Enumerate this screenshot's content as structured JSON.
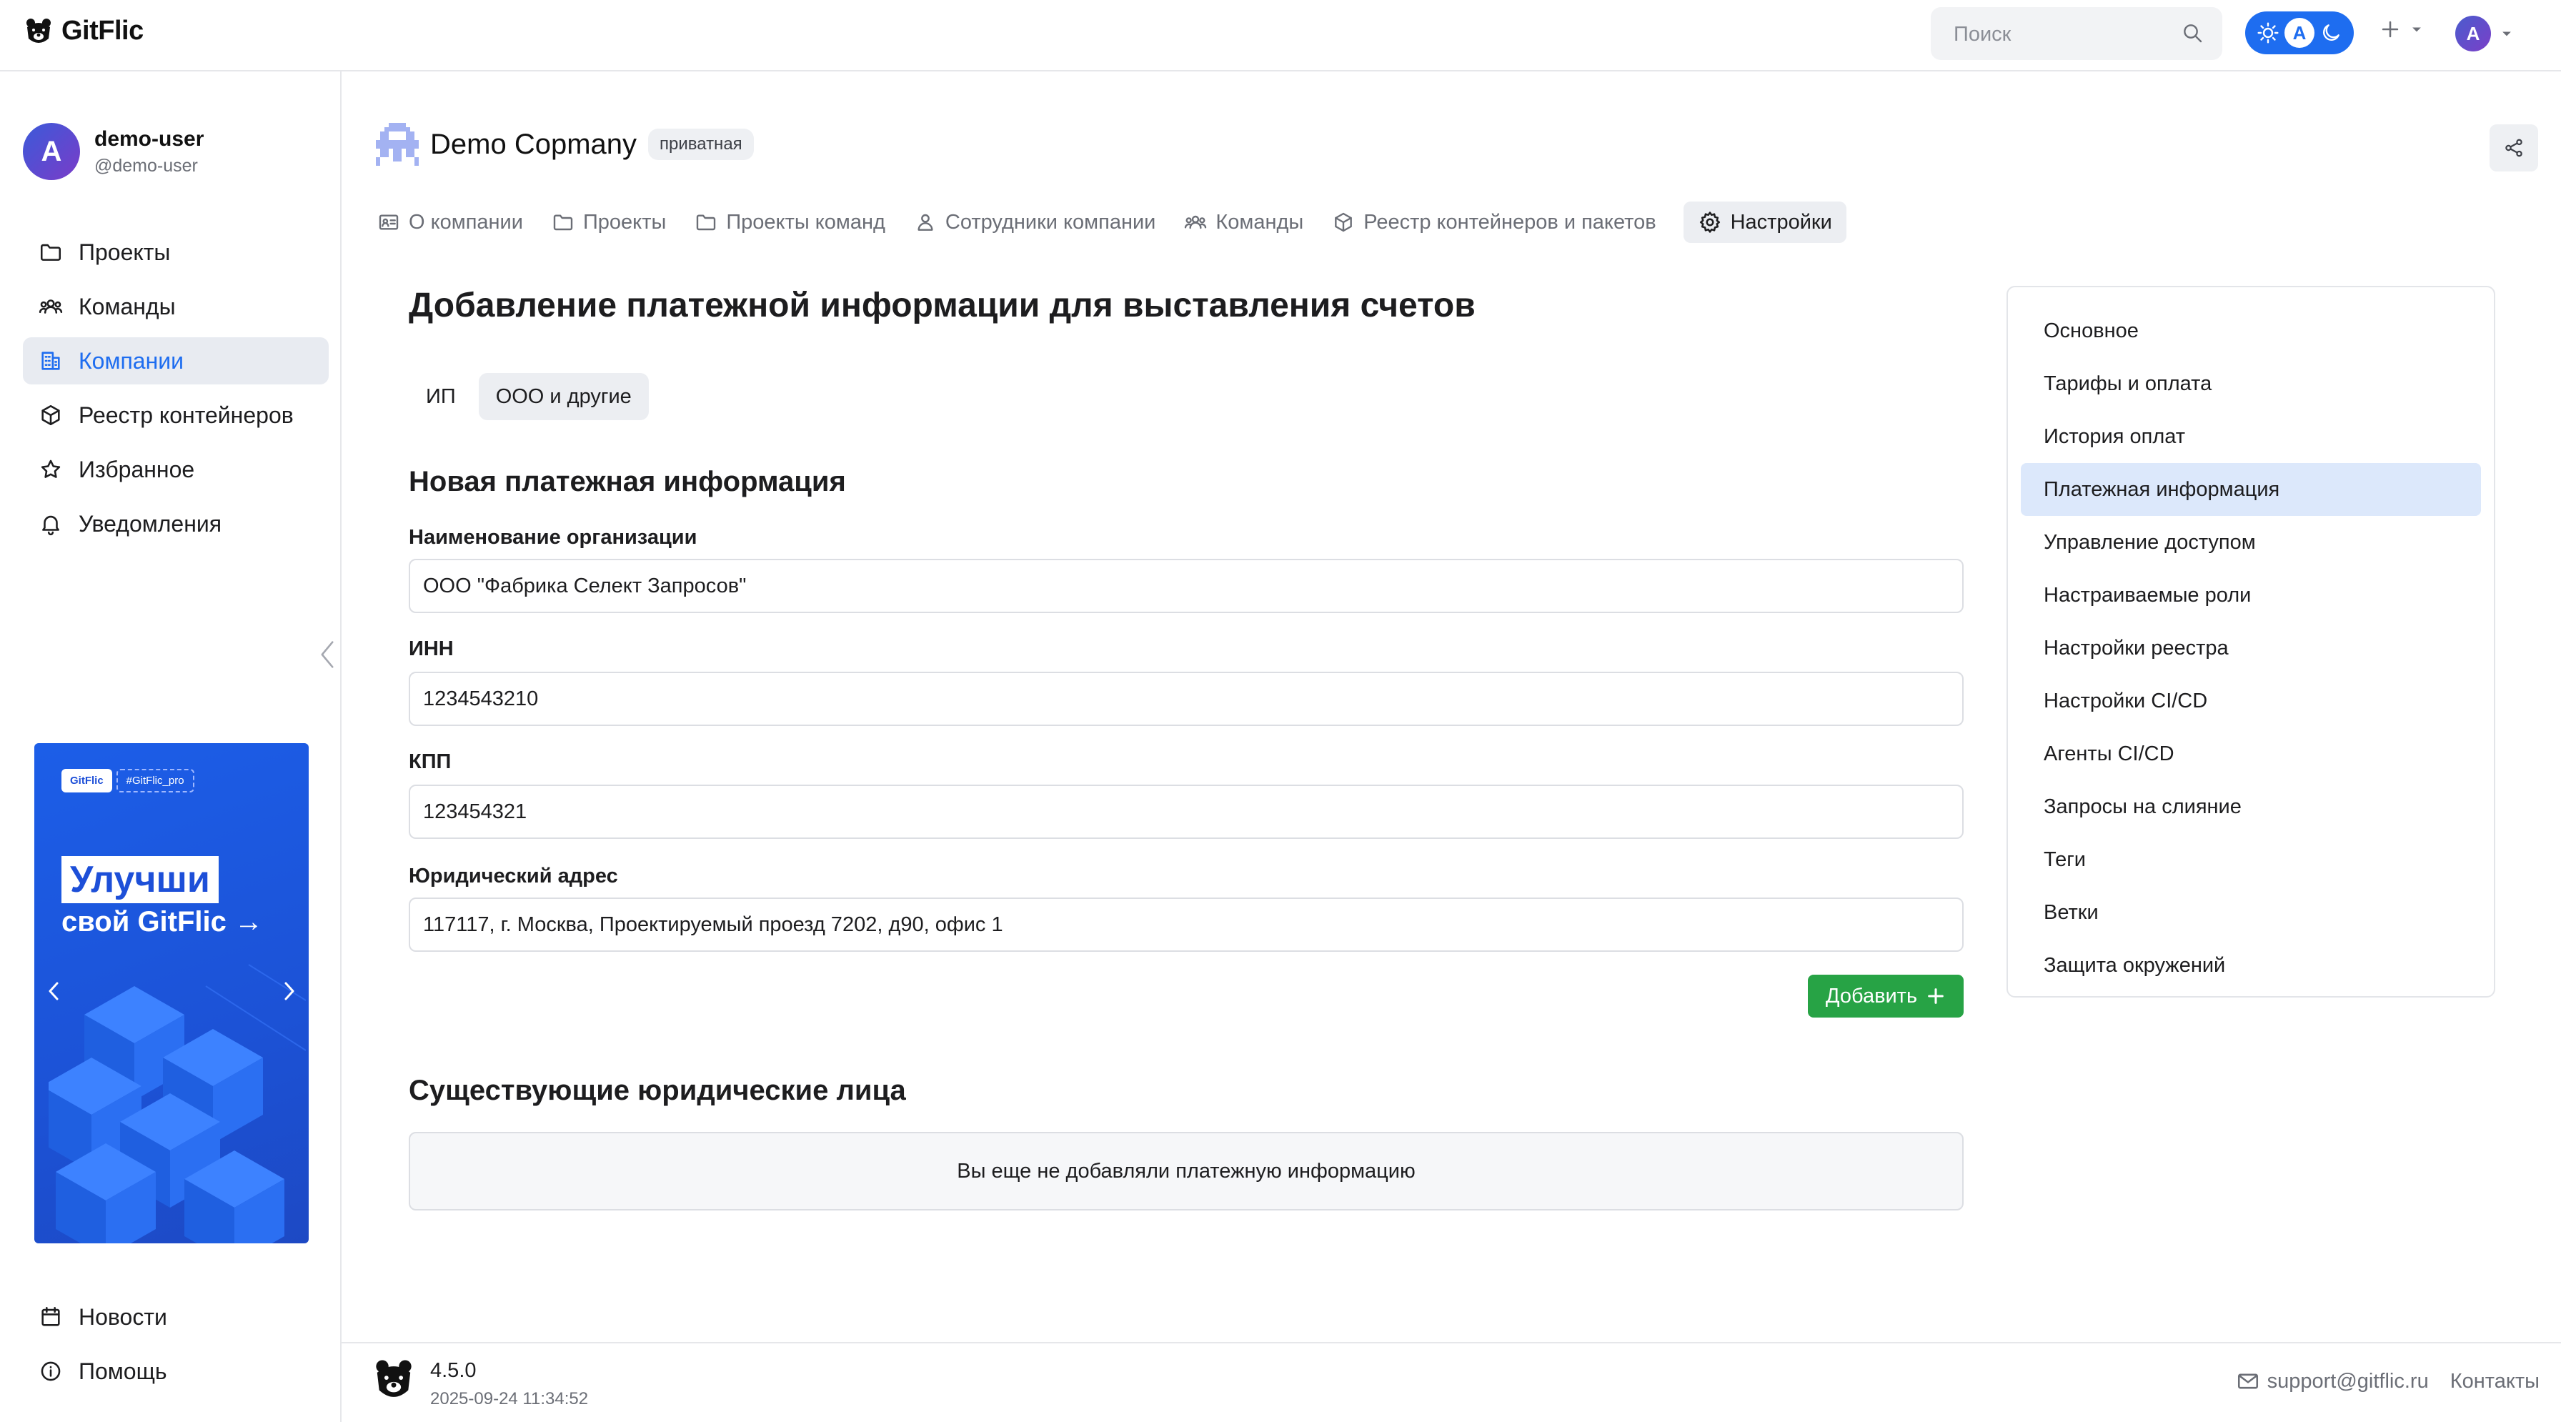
{
  "app": {
    "name": "GitFlic"
  },
  "header": {
    "search_placeholder": "Поиск",
    "avatar_initial": "A"
  },
  "user": {
    "name": "demo-user",
    "handle": "@demo-user",
    "avatar_initial": "A"
  },
  "sidebar": {
    "items": [
      {
        "label": "Проекты",
        "icon": "folder-icon"
      },
      {
        "label": "Команды",
        "icon": "users-icon"
      },
      {
        "label": "Компании",
        "icon": "building-icon",
        "active": true
      },
      {
        "label": "Реестр контейнеров",
        "icon": "box-icon"
      },
      {
        "label": "Избранное",
        "icon": "star-icon"
      },
      {
        "label": "Уведомления",
        "icon": "bell-icon"
      }
    ],
    "bottom_items": [
      {
        "label": "Новости",
        "icon": "calendar-icon"
      },
      {
        "label": "Помощь",
        "icon": "info-icon"
      }
    ],
    "promo": {
      "brand": "GitFlic",
      "tag": "#GitFlic_pro",
      "headline": "Улучши",
      "subline": "свой GitFlic →"
    }
  },
  "org": {
    "name": "Demo Copmany",
    "visibility_badge": "приватная"
  },
  "tabs": [
    {
      "label": "О компании",
      "icon": "id-card-icon"
    },
    {
      "label": "Проекты",
      "icon": "folder-icon"
    },
    {
      "label": "Проекты команд",
      "icon": "folder-icon"
    },
    {
      "label": "Сотрудники компании",
      "icon": "person-icon"
    },
    {
      "label": "Команды",
      "icon": "users-icon"
    },
    {
      "label": "Реестр контейнеров и пакетов",
      "icon": "box-icon"
    },
    {
      "label": "Настройки",
      "icon": "gear-icon",
      "active": true
    }
  ],
  "main": {
    "title": "Добавление платежной информации для выставления счетов",
    "subtabs": [
      {
        "label": "ИП",
        "active": false
      },
      {
        "label": "ООО и другие",
        "active": true
      }
    ],
    "form_title": "Новая платежная информация",
    "fields": {
      "org_name": {
        "label": "Наименование организации",
        "value": "ООО \"Фабрика Селект Запросов\""
      },
      "inn": {
        "label": "ИНН",
        "value": "1234543210"
      },
      "kpp": {
        "label": "КПП",
        "value": "123454321"
      },
      "address": {
        "label": "Юридический адрес",
        "value": "117117, г. Москва,  Проектируемый проезд 7202, д90, офис 1"
      }
    },
    "add_button": "Добавить",
    "existing_title": "Существующие юридические лица",
    "empty_message": "Вы еще не добавляли платежную информацию"
  },
  "settings_menu": [
    {
      "label": "Основное"
    },
    {
      "label": "Тарифы и оплата"
    },
    {
      "label": "История оплат"
    },
    {
      "label": "Платежная информация",
      "active": true
    },
    {
      "label": "Управление доступом"
    },
    {
      "label": "Настраиваемые роли"
    },
    {
      "label": "Настройки реестра"
    },
    {
      "label": "Настройки CI/CD"
    },
    {
      "label": "Агенты CI/CD"
    },
    {
      "label": "Запросы на слияние"
    },
    {
      "label": "Теги"
    },
    {
      "label": "Ветки"
    },
    {
      "label": "Защита окружений"
    }
  ],
  "footer": {
    "version": "4.5.0",
    "build_date": "2025-09-24 11:34:52",
    "support_email": "support@gitflic.ru",
    "contacts": "Контакты"
  },
  "colors": {
    "accent": "#1e6df0",
    "success": "#27a345",
    "active_bg": "#dce8fb"
  }
}
